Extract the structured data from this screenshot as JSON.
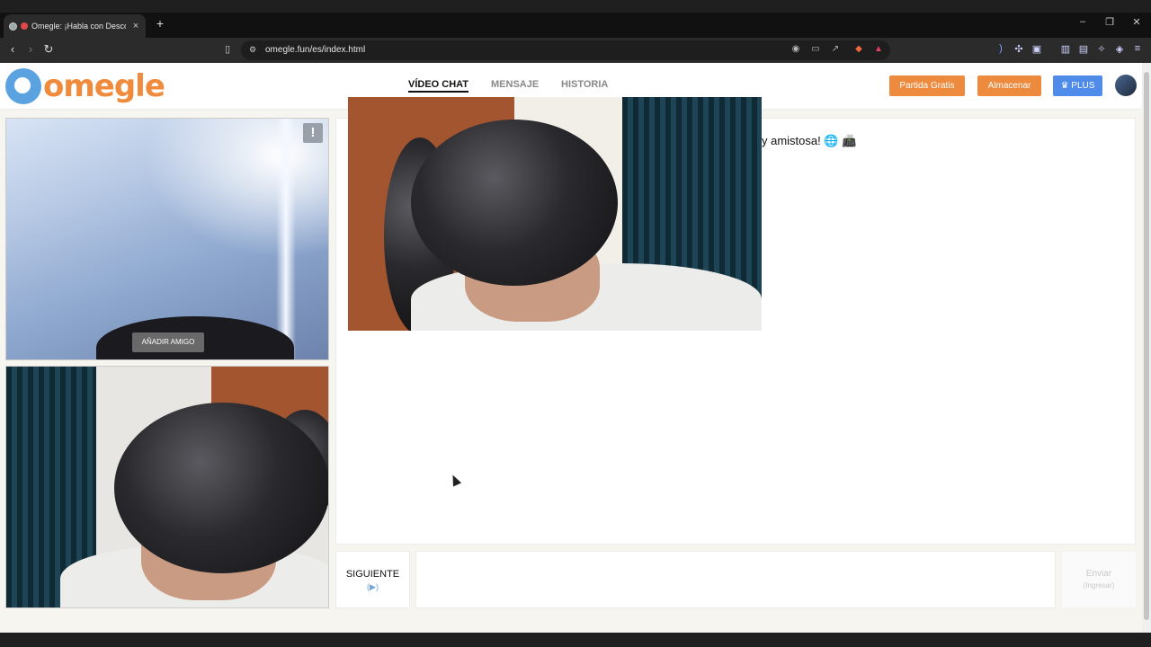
{
  "browser": {
    "tab_title": "Omegle: ¡Habla con Desconoc",
    "tab_close": "×",
    "new_tab": "+",
    "url": "omegle.fun/es/index.html",
    "window_controls": [
      "–",
      "❐",
      "✕"
    ]
  },
  "header": {
    "logo_text": "omegle",
    "nav": [
      {
        "label": "VÍDEO CHAT",
        "active": true
      },
      {
        "label": "MENSAJE",
        "active": false
      },
      {
        "label": "HISTORIA",
        "active": false
      }
    ],
    "buttons": [
      {
        "label": "Partida Gratis",
        "color": "#ee8a3e"
      },
      {
        "label": "Almacenar",
        "color": "#ee8a3e"
      },
      {
        "label": "♛ PLUS",
        "color": "#4f8be8"
      }
    ]
  },
  "video": {
    "report_label": "!",
    "add_friend_label": "AÑADIR AMIGO"
  },
  "chat": {
    "message": "y amistosa! 🌐 📠"
  },
  "footer": {
    "next_label": "SIGUIENTE",
    "next_hint": "(▶)",
    "send_label": "Enviar",
    "send_hint": "(Ingresar)"
  }
}
